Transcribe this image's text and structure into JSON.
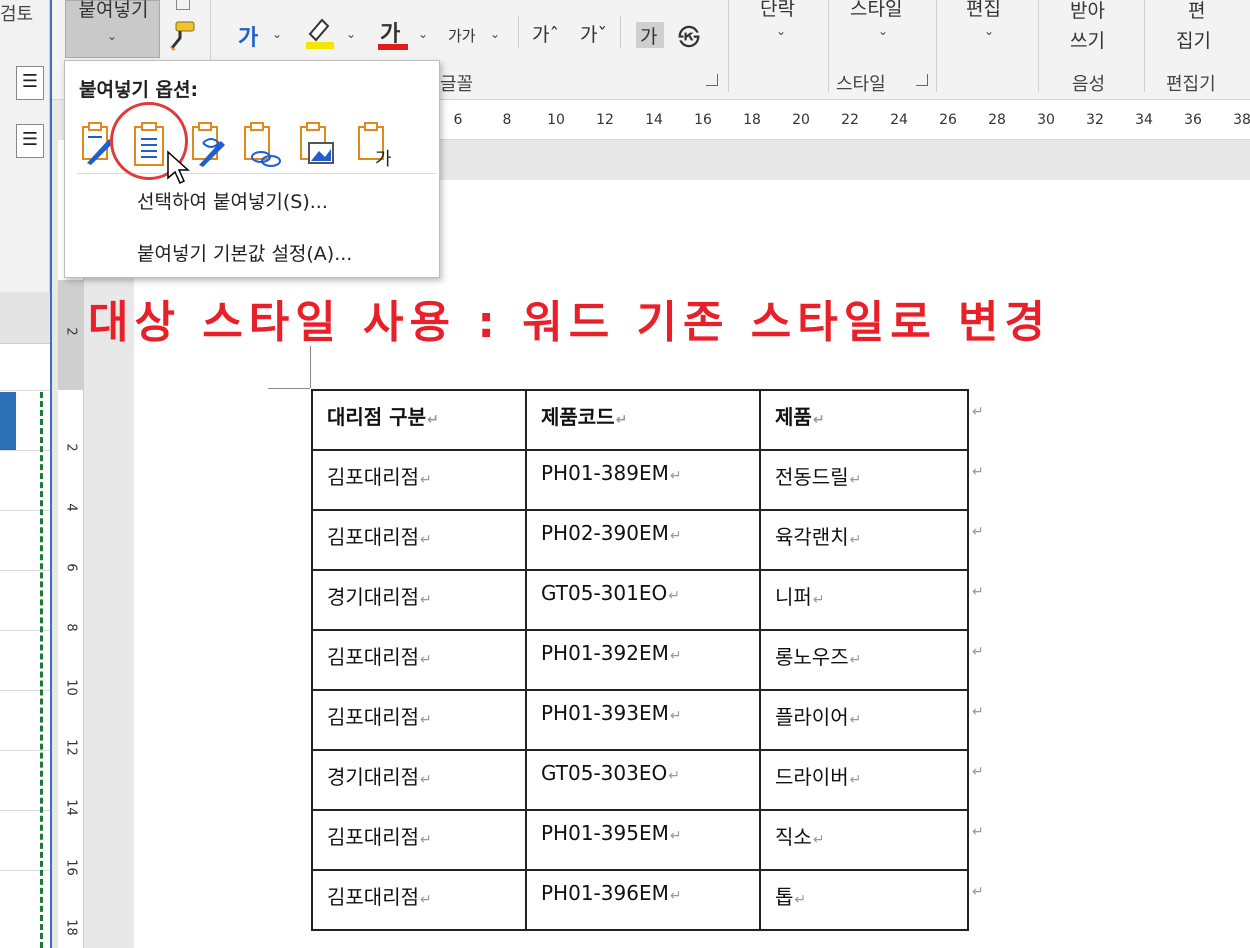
{
  "left_window": {
    "title": "검토"
  },
  "ribbon": {
    "paste_label": "붙여넣기",
    "format_buttons": [
      "가",
      "가",
      "가가",
      "가ˆ",
      "가ˇ",
      "가",
      "㉿"
    ],
    "font_group_label": "글꼴",
    "paragraph_label": "단락",
    "styles_label": "스타일",
    "styles_group_label": "스타일",
    "editing_label": "편집",
    "dictate_label_1": "받아",
    "dictate_label_2": "쓰기",
    "voice_group_label": "음성",
    "editor_label_1": "편",
    "editor_label_2": "집기",
    "editor_group_label": "편집기",
    "colors": {
      "highlight": "#f3e600",
      "font_color": "#e01b1b",
      "blue_text": "#1f5fd0"
    }
  },
  "ruler": {
    "ticks": [
      "6",
      "8",
      "10",
      "12",
      "14",
      "16",
      "18",
      "20",
      "22",
      "24",
      "26",
      "28",
      "30",
      "32",
      "34",
      "36",
      "38"
    ]
  },
  "vertical_ruler": {
    "ticks": [
      "2",
      "2",
      "4",
      "6",
      "8",
      "10",
      "12",
      "14",
      "16",
      "18"
    ]
  },
  "paste_options": {
    "title": "붙여넣기 옵션:",
    "icons": [
      "keep-source-formatting-icon",
      "use-destination-styles-icon",
      "merge-formatting-icon",
      "link-keep-source-icon",
      "picture-icon",
      "keep-text-only-icon"
    ],
    "paste_special": "선택하여 붙여넣기(S)...",
    "set_default": "붙여넣기 기본값 설정(A)..."
  },
  "annotation": {
    "headline": "대상 스타일 사용 : 워드 기존 스타일로 변경",
    "color": "#e8202a"
  },
  "table": {
    "headers": [
      "대리점 구분",
      "제품코드",
      "제품"
    ],
    "rows": [
      [
        "김포대리점",
        "PH01-389EM",
        "전동드릴"
      ],
      [
        "김포대리점",
        "PH02-390EM",
        "육각랜치"
      ],
      [
        "경기대리점",
        "GT05-301EO",
        "니퍼"
      ],
      [
        "김포대리점",
        "PH01-392EM",
        "롱노우즈"
      ],
      [
        "김포대리점",
        "PH01-393EM",
        "플라이어"
      ],
      [
        "경기대리점",
        "GT05-303EO",
        "드라이버"
      ],
      [
        "김포대리점",
        "PH01-395EM",
        "직소"
      ],
      [
        "김포대리점",
        "PH01-396EM",
        "톱"
      ]
    ],
    "cell_mark": "↵",
    "row_mark": "↵"
  }
}
